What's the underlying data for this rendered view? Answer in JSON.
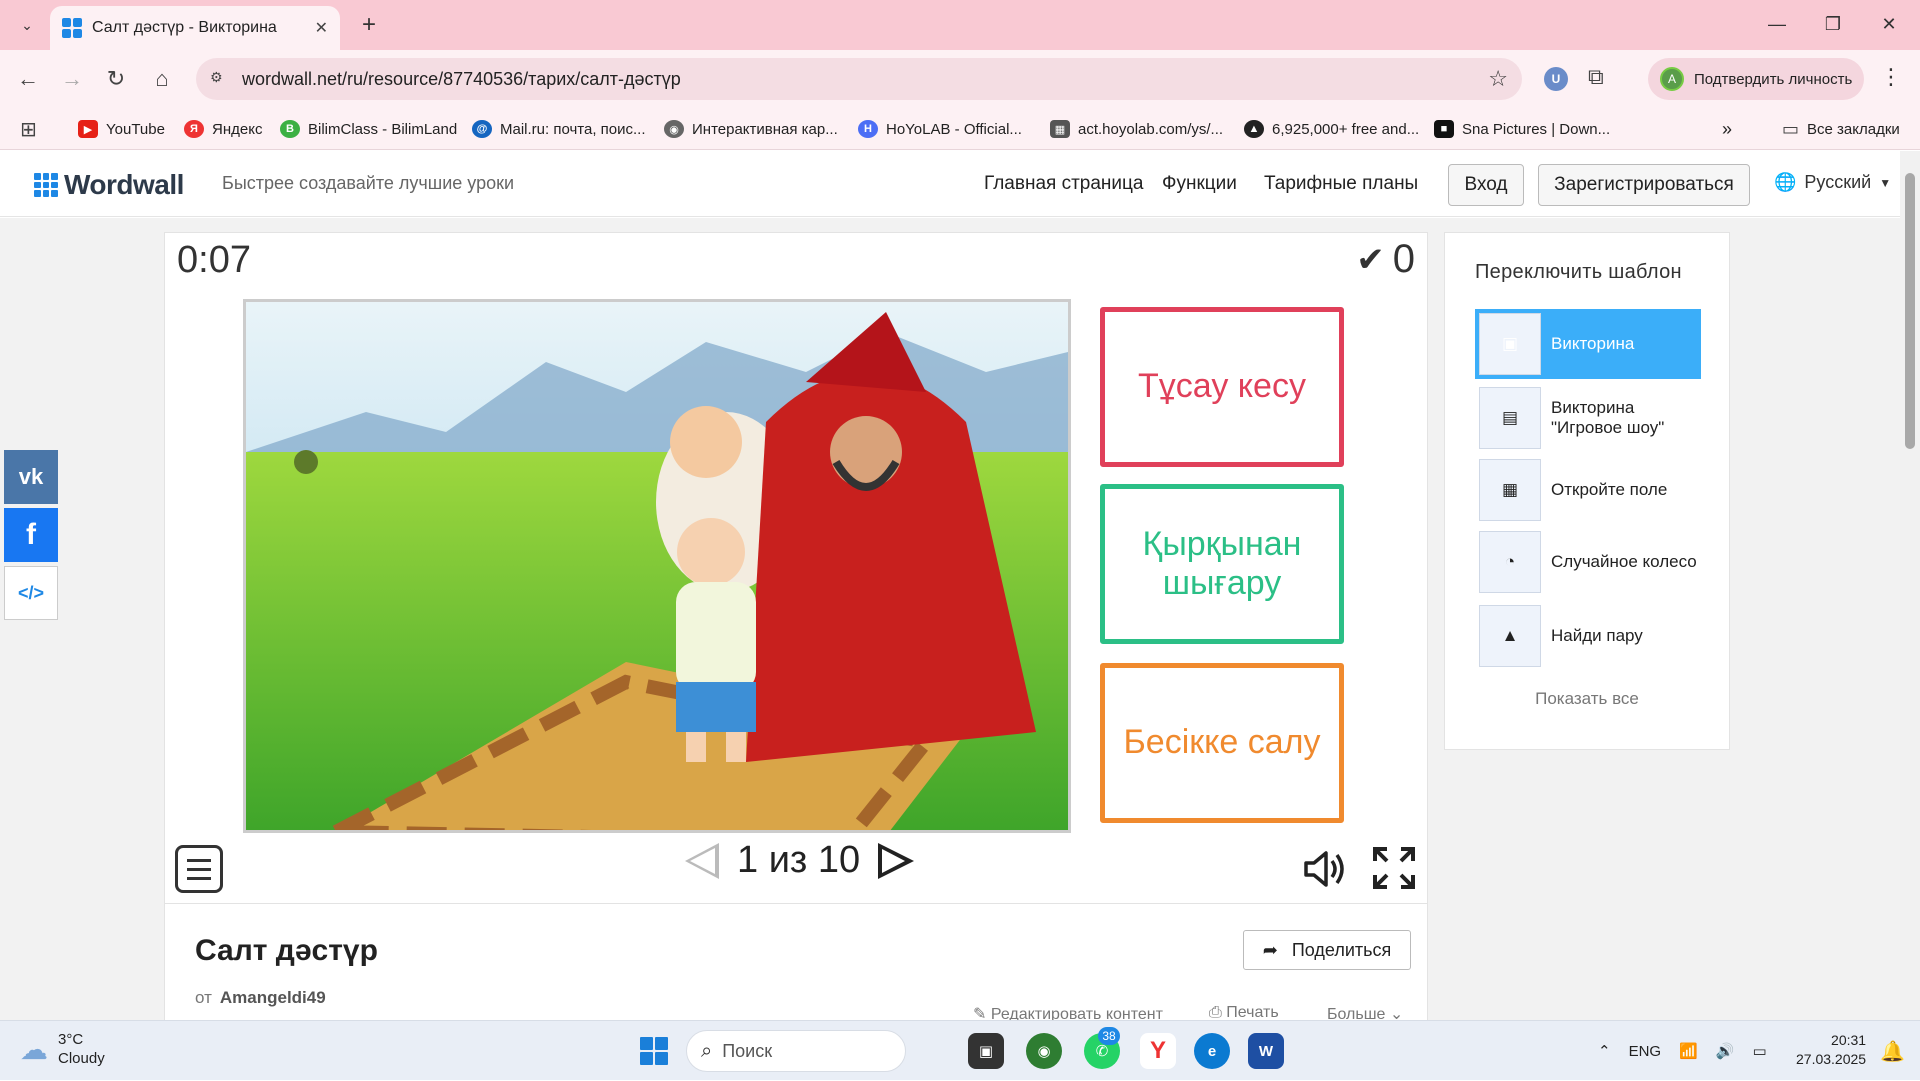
{
  "browser": {
    "tab_title": "Салт дәстүр - Викторина",
    "url": "wordwall.net/ru/resource/87740536/тарих/салт-дәстүр",
    "verify_label": "Подтвердить личность",
    "verify_avatar": "A",
    "ext_u_label": "U"
  },
  "bookmarks": [
    {
      "label": "YouTube",
      "icon": "youtube-icon",
      "color": "#e62117"
    },
    {
      "label": "Яндекс",
      "icon": "yandex-icon",
      "color": "#e33"
    },
    {
      "label": "BilimClass - BilimLand",
      "icon": "bilimclass-icon",
      "color": "#3cb043"
    },
    {
      "label": "Mail.ru: почта, поис...",
      "icon": "mailru-icon",
      "color": "#1565c0"
    },
    {
      "label": "Интерактивная кар...",
      "icon": "map-icon",
      "color": "#666"
    },
    {
      "label": "HoYoLAB - Official...",
      "icon": "hoyolab-icon",
      "color": "#4c6ef5"
    },
    {
      "label": "act.hoyolab.com/ys/...",
      "icon": "act-hoyolab-icon",
      "color": "#555"
    },
    {
      "label": "6,925,000+ free and...",
      "icon": "free-assets-icon",
      "color": "#222"
    },
    {
      "label": "Sna Pictures | Down...",
      "icon": "sna-icon",
      "color": "#111"
    }
  ],
  "all_bookmarks_label": "Все закладки",
  "header": {
    "logo": "Wordwall",
    "tagline": "Быстрее создавайте лучшие уроки",
    "nav": [
      "Главная страница",
      "Функции",
      "Тарифные планы"
    ],
    "login": "Вход",
    "register": "Зарегистрироваться",
    "language": "Русский"
  },
  "game": {
    "timer": "0:07",
    "score": "0",
    "page_indicator": "1 из 10",
    "answers": [
      {
        "text": "Тұсау кесу",
        "color": "#e0405a"
      },
      {
        "text": "Қырқынан шығару",
        "color": "#2bbf86"
      },
      {
        "text": "Бесікке салу",
        "color": "#f08a2e"
      }
    ],
    "picture_description_icon": "quiz-picture"
  },
  "activity": {
    "title": "Салт дәстүр",
    "author_prefix": "от",
    "author": "Amangeldi49",
    "share": "Поделиться",
    "edit": "Редактировать контент",
    "print": "Печать",
    "more": "Больше"
  },
  "sidebar": {
    "title": "Переключить шаблон",
    "templates": [
      {
        "label": "Викторина",
        "active": true
      },
      {
        "label": "Викторина \"Игровое шоу\"",
        "active": false
      },
      {
        "label": "Откройте поле",
        "active": false
      },
      {
        "label": "Случайное колесо",
        "active": false
      },
      {
        "label": "Найди пару",
        "active": false
      }
    ],
    "show_all": "Показать все"
  },
  "taskbar": {
    "weather_temp": "3°C",
    "weather_desc": "Cloudy",
    "search_placeholder": "Поиск",
    "whatsapp_badge": "38",
    "lang": "ENG",
    "time": "20:31",
    "date": "27.03.2025"
  },
  "colors": {
    "accent": "#3baef9",
    "tab_bg": "#f9c9d3",
    "brand": "#1e88e5"
  }
}
